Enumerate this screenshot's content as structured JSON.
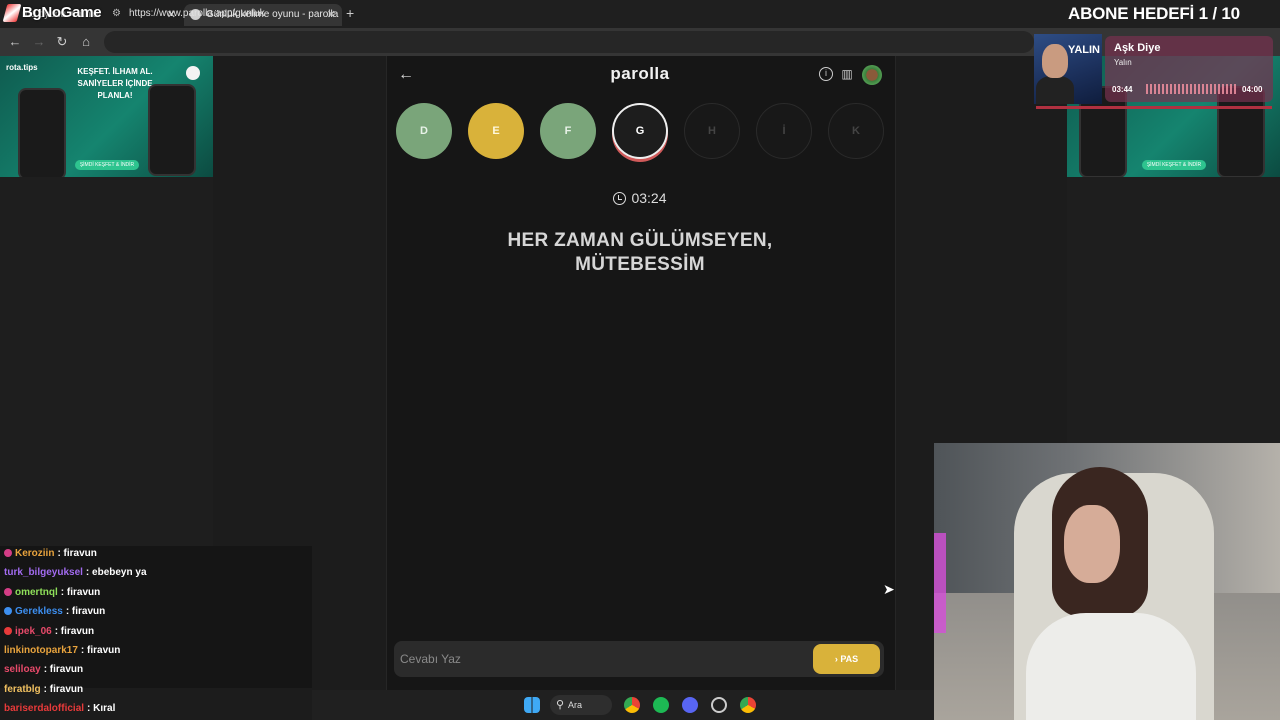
{
  "stream": {
    "name": "BgNoGame",
    "goal": "ABONE HEDEFİ 1 / 10"
  },
  "browser": {
    "tabs": [
      {
        "title": "me oyunu. Günlü"
      },
      {
        "title": "Günlük kelime oyunu - parolla"
      }
    ],
    "new_tab": "+",
    "url": "https://www.parolla.app/gunluk"
  },
  "ad": {
    "brand": "rota.tips",
    "headline": "KEŞFET. İLHAM AL. SANİYELER İÇİNDE PLANLA!",
    "cta": "ŞİMDİ KEŞFET & İNDİR"
  },
  "game": {
    "title": "parolla",
    "letters": [
      {
        "char": "D",
        "state": "correct"
      },
      {
        "char": "E",
        "state": "passed"
      },
      {
        "char": "F",
        "state": "correct"
      },
      {
        "char": "G",
        "state": "current"
      },
      {
        "char": "H",
        "state": "pending"
      },
      {
        "char": "İ",
        "state": "pending"
      },
      {
        "char": "K",
        "state": "pending"
      }
    ],
    "timer": "03:24",
    "clue_line1": "HER ZAMAN GÜLÜMSEYEN,",
    "clue_line2": "MÜTEBESSİM",
    "answer_placeholder": "Cevabı Yaz",
    "pass_label": "› PAS",
    "colors": {
      "correct": "#7aa57a",
      "passed": "#d9b23a",
      "current_ring": "#d05a5a"
    }
  },
  "chat": [
    {
      "user": "Keroziin",
      "msg": ": firavun",
      "color": "#e8a33d",
      "badge": "#d43d86"
    },
    {
      "user": "turk_bilgeyuksel",
      "msg": ": ebebeyn ya",
      "color": "#a26bf0",
      "badge": ""
    },
    {
      "user": "omertnql",
      "msg": ": firavun",
      "color": "#8fe05a",
      "badge": "#d43d86"
    },
    {
      "user": "Gerekless",
      "msg": ": firavun",
      "color": "#3d8ff0",
      "badge": "#3d8ff0"
    },
    {
      "user": "ipek_06",
      "msg": ": firavun",
      "color": "#e84a6a",
      "badge": "#e83a3a"
    },
    {
      "user": "linkinotopark17",
      "msg": ": firavun",
      "color": "#e8a33d",
      "badge": ""
    },
    {
      "user": "seliloay",
      "msg": ": firavun",
      "color": "#e84a6a",
      "badge": ""
    },
    {
      "user": "feratblg",
      "msg": ": firavun",
      "color": "#f0c060",
      "badge": ""
    },
    {
      "user": "bariserdalofficial",
      "msg": ": Kıral",
      "color": "#e83a3a",
      "badge": ""
    }
  ],
  "music": {
    "art_text": "YALIN",
    "song": "Aşk Diye",
    "artist": "Yalın",
    "current": "03:44",
    "total": "04:00"
  },
  "taskbar": {
    "search": "Ara"
  }
}
